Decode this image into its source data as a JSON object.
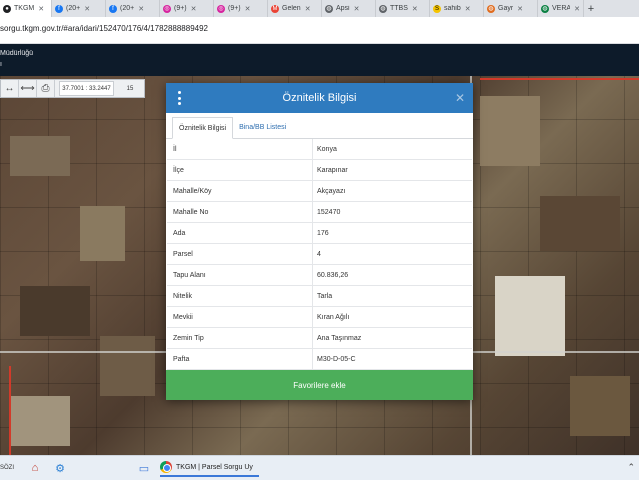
{
  "browser": {
    "tabs": [
      {
        "label": "TKGM",
        "icon": "location-pin-icon",
        "color": "#202124",
        "active": true
      },
      {
        "label": "(20+",
        "icon": "facebook-icon",
        "color": "#1877f2"
      },
      {
        "label": "(20+",
        "icon": "facebook-icon",
        "color": "#1877f2"
      },
      {
        "label": "(9+)",
        "icon": "instagram-icon",
        "color": "#d6249f"
      },
      {
        "label": "(9+)",
        "icon": "instagram-icon",
        "color": "#d6249f"
      },
      {
        "label": "Gelen",
        "icon": "gmail-icon",
        "color": "#ea4335"
      },
      {
        "label": "Apsi",
        "icon": "site-icon",
        "color": "#5f6368"
      },
      {
        "label": "TTBS",
        "icon": "site-icon",
        "color": "#5f6368"
      },
      {
        "label": "sahib",
        "icon": "sahibinden-icon",
        "color": "#f5c400"
      },
      {
        "label": "Gayr",
        "icon": "site-icon",
        "color": "#e06c1f"
      },
      {
        "label": "VERA",
        "icon": "site-icon",
        "color": "#0b8043"
      }
    ],
    "url": "sorgu.tkgm.gov.tr/#ara/idari/152470/176/4/1782888889492"
  },
  "site": {
    "org": "Müdürlüğü",
    "sub": "ı"
  },
  "map_toolbar": {
    "coordinates": "37.7001 : 33.2447",
    "zoom": "15"
  },
  "modal": {
    "title": "Öznitelik Bilgisi",
    "tabs": [
      "Öznitelik Bilgisi",
      "Bina/BB Listesi"
    ],
    "rows": [
      {
        "key": "İl",
        "value": "Konya"
      },
      {
        "key": "İlçe",
        "value": "Karapınar"
      },
      {
        "key": "Mahalle/Köy",
        "value": "Akçayazı"
      },
      {
        "key": "Mahalle No",
        "value": "152470"
      },
      {
        "key": "Ada",
        "value": "176"
      },
      {
        "key": "Parsel",
        "value": "4"
      },
      {
        "key": "Tapu Alanı",
        "value": "60.836,26"
      },
      {
        "key": "Nitelik",
        "value": "Tarla"
      },
      {
        "key": "Mevkii",
        "value": "Kıran Ağılı"
      },
      {
        "key": "Zemin Tip",
        "value": "Ana Taşınmaz"
      },
      {
        "key": "Pafta",
        "value": "M30-D-05-C"
      }
    ],
    "fav_button": "Favorilere ekle"
  },
  "taskbar": {
    "left_text": "SÖZI",
    "app_label": "TKGM | Parsel Sorgu Uy"
  },
  "colors": {
    "modal_header": "#2f7bbf",
    "fav_button": "#4cae5a"
  }
}
